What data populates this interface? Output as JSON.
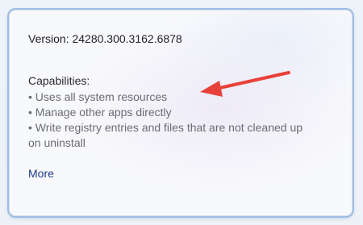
{
  "panel": {
    "version_text": "Version: 24280.300.3162.6878",
    "capabilities_heading": "Capabilities:",
    "capabilities": [
      "• Uses all system resources",
      "• Manage other apps directly",
      "• Write registry entries and files that are not cleaned up",
      "on uninstall"
    ],
    "more_link": "More"
  },
  "annotation": {
    "arrow_color": "#e8413a",
    "arrow_icon": "red-arrow-icon"
  }
}
